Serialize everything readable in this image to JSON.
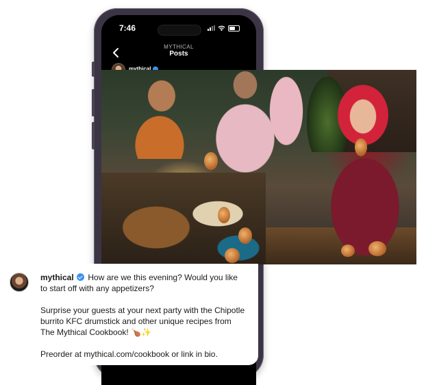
{
  "status_bar": {
    "time": "7:46"
  },
  "header": {
    "account": "MYTHICAL",
    "title": "Posts"
  },
  "post": {
    "username": "mythical",
    "verified": true,
    "more_icon": "···",
    "caption": {
      "line1": "How are we this evening? Would you like to start off with any appetizers?",
      "line2": "Surprise your guests at your next party with the Chipotle burrito KFC drumstick and other unique recipes from The Mythical Cookbook! 🍗✨",
      "line3_prefix": "Preorder at ",
      "line3_link": "mythical.com/cookbook",
      "line3_suffix": " or link in bio."
    }
  },
  "colors": {
    "phone_frame": "#3b3445",
    "screen_bg": "#000000",
    "verified": "#3b92f2"
  },
  "icons": [
    "back-icon",
    "signal-icon",
    "wifi-icon",
    "battery-icon",
    "verified-icon",
    "more-icon"
  ]
}
